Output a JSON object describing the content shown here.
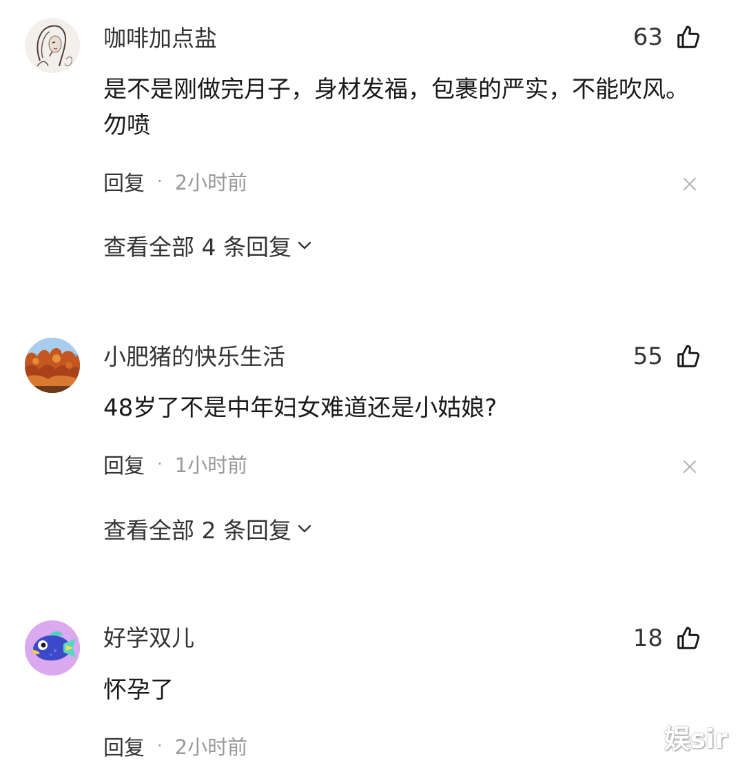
{
  "comments": [
    {
      "username": "咖啡加点盐",
      "likes": "63",
      "text": "是不是刚做完月子，身材发福，包裹的严实，不能吹风。勿喷",
      "reply_label": "回复",
      "separator": "·",
      "time": "2小时前",
      "expand_label": "查看全部 4 条回复",
      "avatar_icon": "sketch-portrait"
    },
    {
      "username": "小肥猪的快乐生活",
      "likes": "55",
      "text": "48岁了不是中年妇女难道还是小姑娘?",
      "reply_label": "回复",
      "separator": "·",
      "time": "1小时前",
      "expand_label": "查看全部 2 条回复",
      "avatar_icon": "autumn-trees"
    },
    {
      "username": "好学双儿",
      "likes": "18",
      "text": "怀孕了",
      "reply_label": "回复",
      "separator": "·",
      "time": "2小时前",
      "avatar_icon": "cartoon-fish"
    }
  ],
  "icons": {
    "like": "thumbs-up-icon",
    "dismiss": "close-icon",
    "expand": "chevron-down-icon"
  },
  "watermark": "娱sir",
  "colors": {
    "text_primary": "#1a1a1a",
    "text_secondary": "#999999",
    "avatar3_bg": "#d9a7ee",
    "fish_body": "#3c49c8"
  }
}
